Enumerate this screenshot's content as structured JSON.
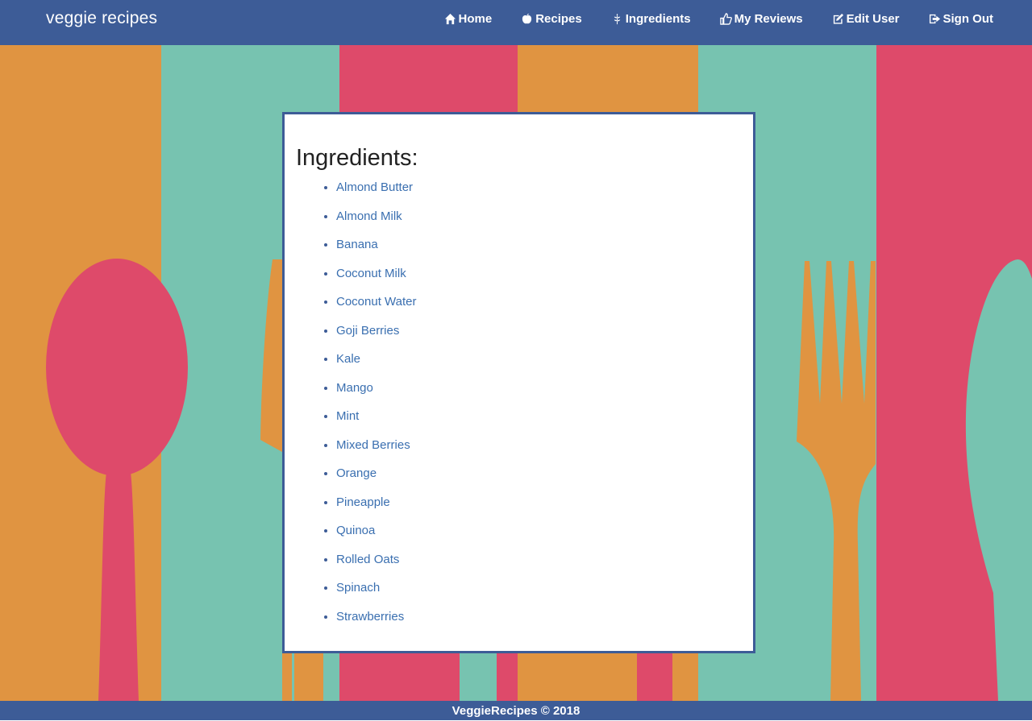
{
  "brand": "veggie recipes",
  "nav": [
    {
      "label": "Home",
      "icon": "home-icon"
    },
    {
      "label": "Recipes",
      "icon": "apple-icon"
    },
    {
      "label": "Ingredients",
      "icon": "grain-icon"
    },
    {
      "label": "My Reviews",
      "icon": "thumbs-up-icon"
    },
    {
      "label": "Edit User",
      "icon": "edit-icon"
    },
    {
      "label": "Sign Out",
      "icon": "sign-out-icon"
    }
  ],
  "heading": "Ingredients:",
  "ingredients": [
    "Almond Butter",
    "Almond Milk",
    "Banana",
    "Coconut Milk",
    "Coconut Water",
    "Goji Berries",
    "Kale",
    "Mango",
    "Mint",
    "Mixed Berries",
    "Orange",
    "Pineapple",
    "Quinoa",
    "Rolled Oats",
    "Spinach",
    "Strawberries"
  ],
  "footer": "VeggieRecipes © 2018",
  "colors": {
    "nav": "#3d5c97",
    "orange": "#e09441",
    "teal": "#77c3b0",
    "pink": "#de4a6a",
    "link": "#3a6fb0"
  }
}
